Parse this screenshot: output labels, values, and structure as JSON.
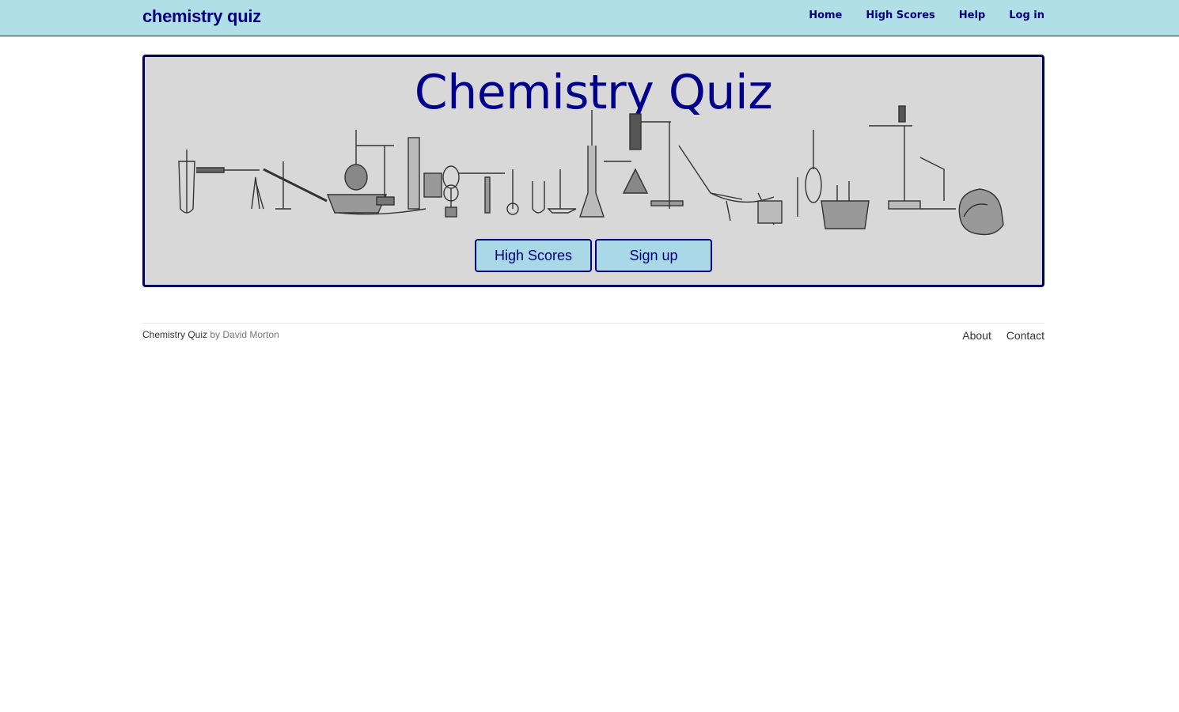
{
  "navbar": {
    "brand": "chemistry quiz",
    "links": [
      "Home",
      "High Scores",
      "Help",
      "Log in"
    ]
  },
  "hero": {
    "title": "Chemistry Quiz",
    "buttons": {
      "high_scores": "High Scores",
      "sign_up": "Sign up"
    }
  },
  "footer": {
    "site_name": "Chemistry Quiz",
    "by": "by",
    "author": "David Morton",
    "links": [
      "About",
      "Contact"
    ]
  },
  "colors": {
    "navbar_bg": "#b0dfe6",
    "brand": "#00007a",
    "hero_bg": "#d8d8d8",
    "button_bg": "#a9d9e6"
  }
}
